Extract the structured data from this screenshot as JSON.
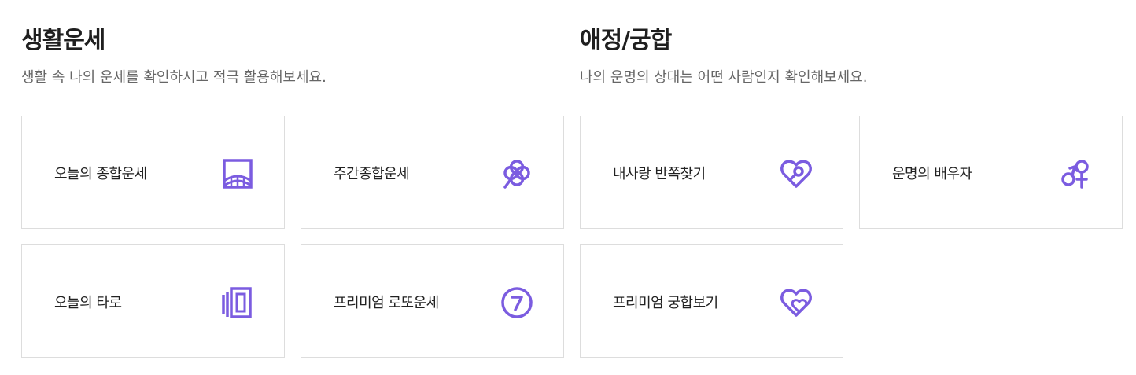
{
  "accent_color": "#7b5ce0",
  "life": {
    "title": "생활운세",
    "subtitle": "생활 속 나의 운세를 확인하시고 적극 활용해보세요.",
    "cards": [
      {
        "label": "오늘의 종합운세",
        "icon": "sunrise-frame-icon"
      },
      {
        "label": "주간종합운세",
        "icon": "clover-icon"
      },
      {
        "label": "오늘의 타로",
        "icon": "tarot-cards-icon"
      },
      {
        "label": "프리미엄 로또운세",
        "icon": "lotto-seven-icon"
      }
    ]
  },
  "love": {
    "title": "애정/궁합",
    "subtitle": "나의 운명의 상대는 어떤 사람인지 확인해보세요.",
    "cards": [
      {
        "label": "내사랑 반쪽찾기",
        "icon": "heart-search-icon"
      },
      {
        "label": "운명의 배우자",
        "icon": "gender-symbols-icon"
      },
      {
        "label": "프리미엄 궁합보기",
        "icon": "double-heart-icon"
      }
    ]
  }
}
